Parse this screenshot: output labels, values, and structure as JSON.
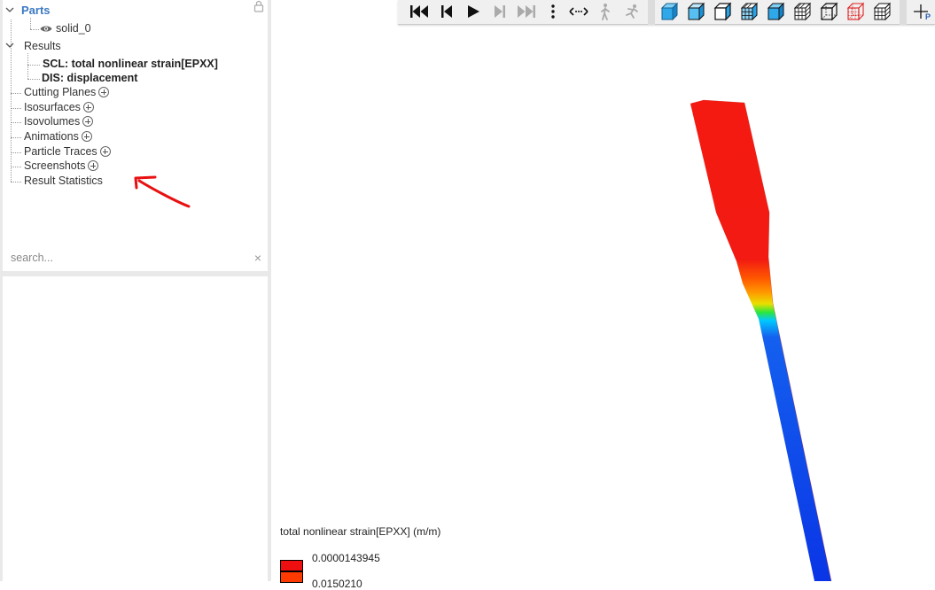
{
  "tree": {
    "parts_label": "Parts",
    "solid_label": "solid_0",
    "results_label": "Results",
    "result_items": [
      "SCL: total nonlinear strain[EPXX]",
      "DIS: displacement"
    ],
    "tools": [
      "Cutting Planes",
      "Isosurfaces",
      "Isovolumes",
      "Animations",
      "Particle Traces",
      "Screenshots",
      "Result Statistics"
    ]
  },
  "search": {
    "placeholder": "search...",
    "value": ""
  },
  "toolbar": {
    "playback": [
      "skip-to-start-icon",
      "step-back-icon",
      "play-icon",
      "step-forward-icon",
      "skip-to-end-icon",
      "more-vertical-icon",
      "pan-arrows-icon",
      "walk-icon",
      "run-icon"
    ],
    "views": [
      "shaded-cube-icon",
      "shaded-edges-cube-icon",
      "cube-outline-icon",
      "cube-mesh-icon",
      "cube-solid-icon",
      "cube-hidden-mesh-icon",
      "cube-wireframe-icon",
      "cube-red-wire-icon",
      "cube-transparent-icon"
    ]
  },
  "legend": {
    "title": "total nonlinear strain[EPXX] (m/m)",
    "values": [
      "0.0000143945",
      "0.0150210"
    ]
  },
  "colors": {
    "parts_blue": "#3b79c3",
    "strain_high": "#ff1a00",
    "strain_low": "#0a35e6",
    "annotation_red": "#e81010"
  }
}
